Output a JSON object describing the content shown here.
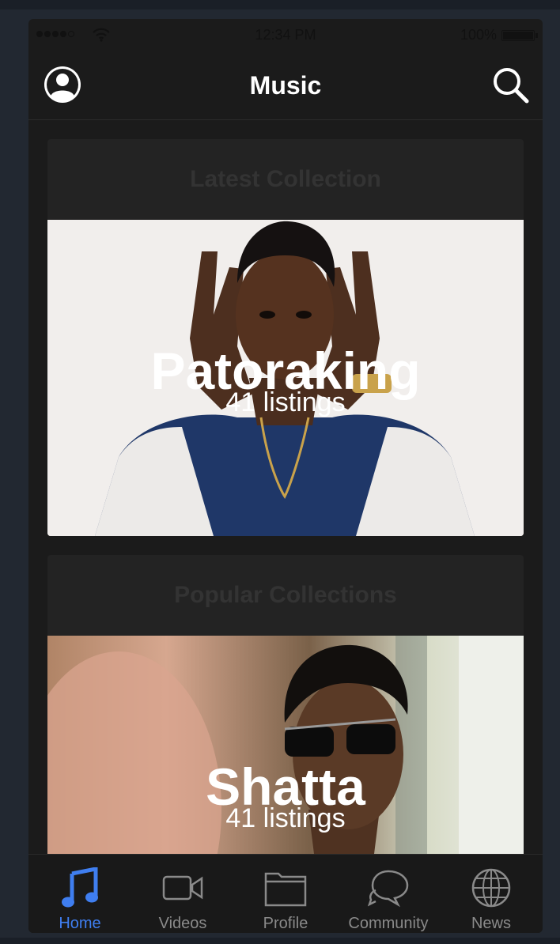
{
  "status_bar": {
    "time": "12:34 PM",
    "battery": "100%"
  },
  "nav": {
    "title": "Music"
  },
  "sections": [
    {
      "header": "Latest Collection",
      "card": {
        "title": "Patoraking",
        "subtitle": "41 listings"
      }
    },
    {
      "header": "Popular Collections",
      "card": {
        "title": "Shatta",
        "subtitle": "41 listings"
      }
    }
  ],
  "tabs": [
    {
      "label": "Home",
      "icon": "music-note-icon",
      "active": true
    },
    {
      "label": "Videos",
      "icon": "video-camera-icon",
      "active": false
    },
    {
      "label": "Profile",
      "icon": "folder-icon",
      "active": false
    },
    {
      "label": "Community",
      "icon": "chat-bubbles-icon",
      "active": false
    },
    {
      "label": "News",
      "icon": "globe-icon",
      "active": false
    }
  ],
  "colors": {
    "background": "#1b1b1b",
    "section_header_bg": "#232323",
    "section_header_text": "#333333",
    "tab_active": "#3f7ef0",
    "tab_inactive": "#8a8a8a"
  }
}
